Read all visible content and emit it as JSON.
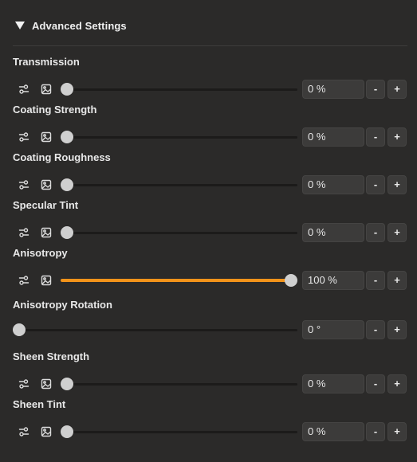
{
  "section": {
    "title": "Advanced Settings",
    "expanded": true
  },
  "colors": {
    "accent": "#f2931a",
    "background": "#2b2a29",
    "field": "#3c3b3a",
    "knob": "#cfcfcf"
  },
  "properties": [
    {
      "label": "Transmission",
      "value": "0 %",
      "fraction": 0.0,
      "has_icons": true
    },
    {
      "label": "Coating Strength",
      "value": "0 %",
      "fraction": 0.0,
      "has_icons": true
    },
    {
      "label": "Coating Roughness",
      "value": "0 %",
      "fraction": 0.0,
      "has_icons": true
    },
    {
      "label": "Specular Tint",
      "value": "0 %",
      "fraction": 0.0,
      "has_icons": true
    },
    {
      "label": "Anisotropy",
      "value": "100 %",
      "fraction": 1.0,
      "has_icons": true
    },
    {
      "label": "Anisotropy Rotation",
      "value": "0 °",
      "fraction": 0.0,
      "has_icons": false
    },
    {
      "label": "Sheen Strength",
      "value": "0 %",
      "fraction": 0.0,
      "has_icons": true
    },
    {
      "label": "Sheen Tint",
      "value": "0 %",
      "fraction": 0.0,
      "has_icons": true
    }
  ],
  "stepper": {
    "minus": "-",
    "plus": "+"
  },
  "icons": {
    "curve": "curve-settings-icon",
    "texture": "image-texture-icon"
  }
}
